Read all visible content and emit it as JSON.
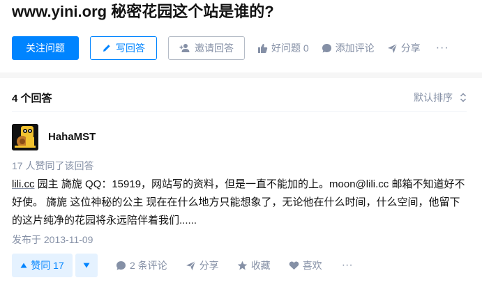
{
  "question": {
    "title": "www.yini.org 秘密花园这个站是谁的?",
    "follow_label": "关注问题",
    "write_answer_label": "写回答",
    "invite_label": "邀请回答",
    "good_question_label": "好问题 0",
    "add_comment_label": "添加评论",
    "share_label": "分享",
    "more_label": "···"
  },
  "answers": {
    "count_label": "4 个回答",
    "sort_label": "默认排序"
  },
  "answer": {
    "author": "HahaMST",
    "vote_meta": "17 人赞同了该回答",
    "body_link": "lili.cc",
    "body_text": " 园主 旖旎 QQ：15919，网站写的资料，但是一直不能加的上。moon@lili.cc 邮箱不知道好不好使。 旖旎 这位神秘的公主 现在在什么地方只能想象了，无论他在什么时间，什么空间，他留下的这片纯净的花园将永远陪伴着我们......",
    "published": "发布于 2013-11-09",
    "vote_up_label": "赞同 17",
    "comments_label": "2 条评论",
    "share_label": "分享",
    "collect_label": "收藏",
    "like_label": "喜欢",
    "more_label": "···"
  },
  "colors": {
    "accent": "#0084ff",
    "muted": "#8590a6",
    "text": "#121212",
    "vote_bg": "#e5f2ff"
  },
  "icons": [
    "pen-icon",
    "invite-person-icon",
    "thumb-up-icon",
    "comment-bubble-icon",
    "share-arrow-icon",
    "sort-chevrons-icon",
    "triangle-up-icon",
    "triangle-down-icon",
    "star-icon",
    "heart-icon",
    "avatar-image"
  ]
}
